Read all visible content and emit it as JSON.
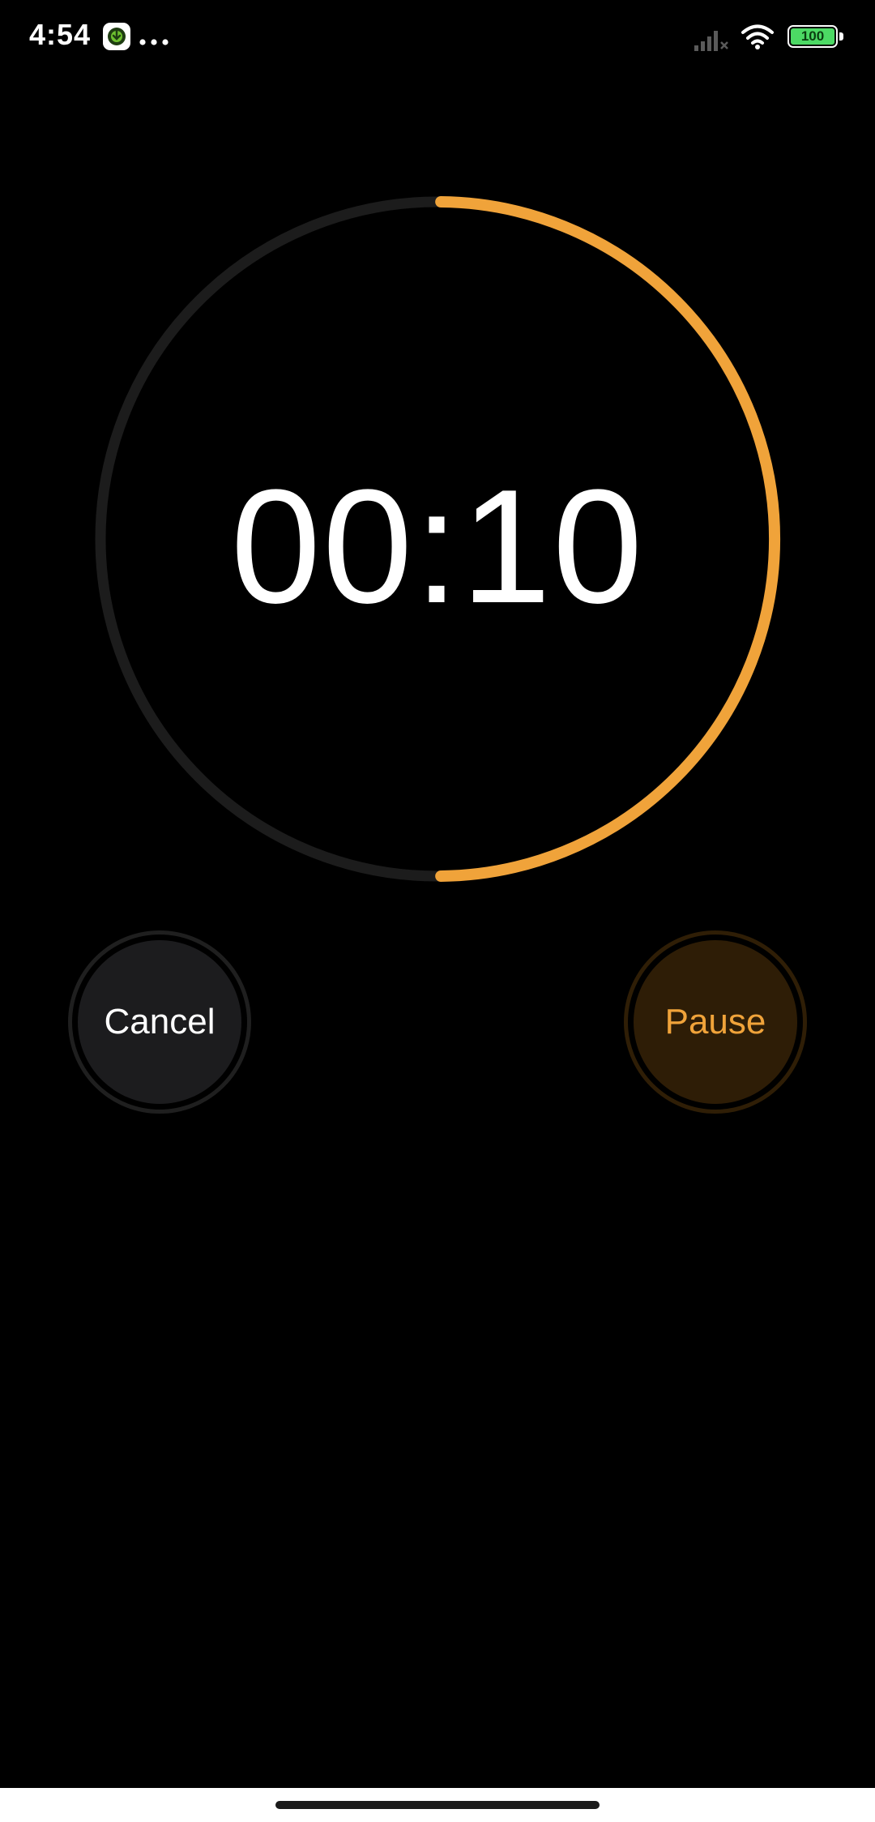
{
  "status_bar": {
    "time": "4:54",
    "battery_level": "100",
    "icons": [
      "app-notification-icon",
      "more-dots-icon",
      "signal-icon",
      "wifi-icon",
      "battery-icon"
    ]
  },
  "timer": {
    "remaining": "00:10",
    "progress_remaining_fraction": 0.5,
    "colors": {
      "progress": "#f0a33a",
      "track": "#1c1c1c"
    }
  },
  "controls": {
    "cancel_label": "Cancel",
    "pause_label": "Pause"
  },
  "colors": {
    "accent": "#f0a33a",
    "background": "#000000",
    "battery_fill": "#4cd964"
  }
}
